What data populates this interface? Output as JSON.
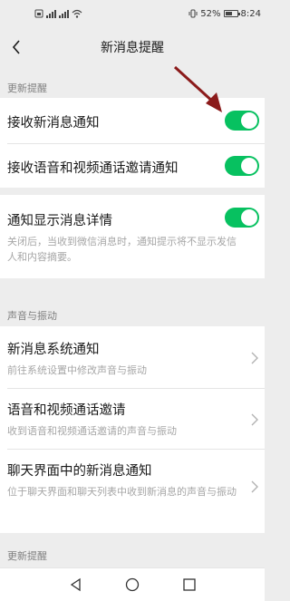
{
  "status_bar": {
    "battery_percent": "52%",
    "time": "8:24",
    "left_icons": [
      "sim-icon",
      "signal-icon",
      "signal-icon",
      "wifi-icon"
    ],
    "right_icons": [
      "vibrate-icon",
      "battery-icon"
    ]
  },
  "nav": {
    "title": "新消息提醒",
    "back_icon": "chevron-left-icon"
  },
  "sections": {
    "update_reminder": "更新提醒",
    "sound_vibration": "声音与振动",
    "update_reminder_2": "更新提醒"
  },
  "rows": {
    "receive_new_msg": {
      "title": "接收新消息通知",
      "enabled": true
    },
    "receive_voice_video": {
      "title": "接收语音和视频通话邀请通知",
      "enabled": true
    },
    "show_details": {
      "title": "通知显示消息详情",
      "subtitle": "关闭后，当收到微信消息时，通知提示将不显示发信人和内容摘要。",
      "enabled": true
    },
    "new_msg_system": {
      "title": "新消息系统通知",
      "subtitle": "前往系统设置中修改声音与振动"
    },
    "voice_video_invite": {
      "title": "语音和视频通话邀请",
      "subtitle": "收到语音和视频通话邀请的声音与振动"
    },
    "chat_new_msg": {
      "title": "聊天界面中的新消息通知",
      "subtitle": "位于聊天界面和聊天列表中收到新消息的声音与振动"
    }
  },
  "colors": {
    "toggle_on": "#07c160",
    "background": "#ededed",
    "annotation_arrow": "#8b1a1a"
  },
  "system_nav": {
    "buttons": [
      "back-triangle-icon",
      "home-circle-icon",
      "recents-square-icon"
    ]
  }
}
